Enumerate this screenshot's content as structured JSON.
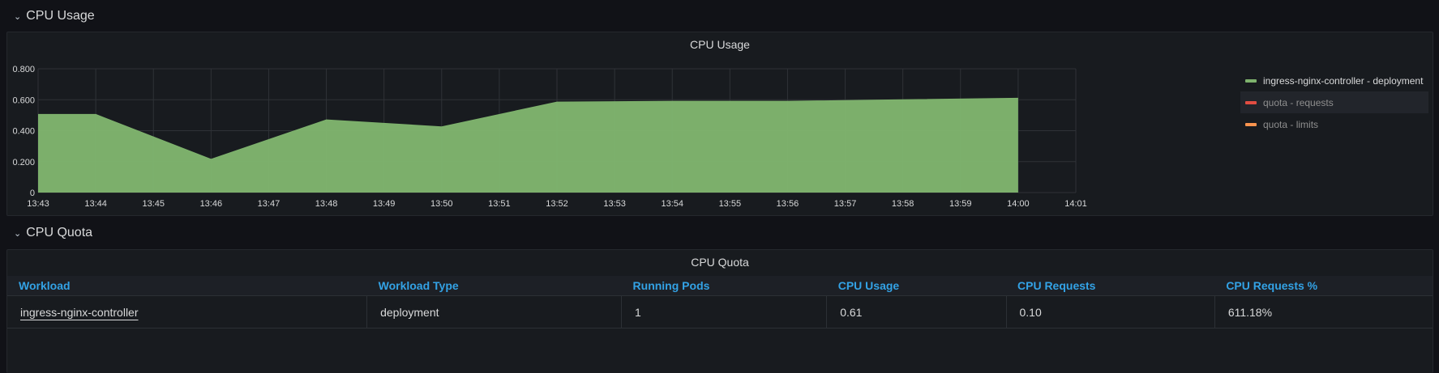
{
  "rows": {
    "cpu_usage_row": "CPU Usage",
    "cpu_quota_row": "CPU Quota"
  },
  "cpu_usage_panel": {
    "title": "CPU Usage",
    "legend": [
      {
        "label": "ingress-nginx-controller - deployment",
        "color": "#7eb26d",
        "text_color": "#d8d9da"
      },
      {
        "label": "quota - requests",
        "color": "#e24d42",
        "text_color": "#8e8e8e"
      },
      {
        "label": "quota - limits",
        "color": "#f9934e",
        "text_color": "#8e8e8e"
      }
    ]
  },
  "chart_data": {
    "type": "area",
    "title": "CPU Usage",
    "x_ticks": [
      "13:43",
      "13:44",
      "13:45",
      "13:46",
      "13:47",
      "13:48",
      "13:49",
      "13:50",
      "13:51",
      "13:52",
      "13:53",
      "13:54",
      "13:55",
      "13:56",
      "13:57",
      "13:58",
      "13:59",
      "14:00",
      "14:01"
    ],
    "y_ticks": [
      "0",
      "0.200",
      "0.400",
      "0.600",
      "0.800"
    ],
    "ylim": [
      0,
      0.8
    ],
    "xlim": [
      "13:43",
      "14:01"
    ],
    "grid": true,
    "legend_position": "right",
    "series": [
      {
        "name": "ingress-nginx-controller - deployment",
        "color": "#7eb26d",
        "x": [
          "13:43",
          "13:44",
          "13:46",
          "13:48",
          "13:50",
          "13:52",
          "13:54",
          "13:56",
          "13:58",
          "14:00"
        ],
        "values": [
          0.505,
          0.505,
          0.215,
          0.47,
          0.425,
          0.585,
          0.59,
          0.59,
          0.6,
          0.61
        ]
      },
      {
        "name": "quota - requests",
        "color": "#e24d42",
        "values": []
      },
      {
        "name": "quota - limits",
        "color": "#f9934e",
        "values": []
      }
    ]
  },
  "cpu_quota_panel": {
    "title": "CPU Quota",
    "columns": [
      "Workload",
      "Workload Type",
      "Running Pods",
      "CPU Usage",
      "CPU Requests",
      "CPU Requests %"
    ],
    "rows": [
      [
        "ingress-nginx-controller",
        "deployment",
        "1",
        "0.61",
        "0.10",
        "611.18%"
      ]
    ]
  }
}
